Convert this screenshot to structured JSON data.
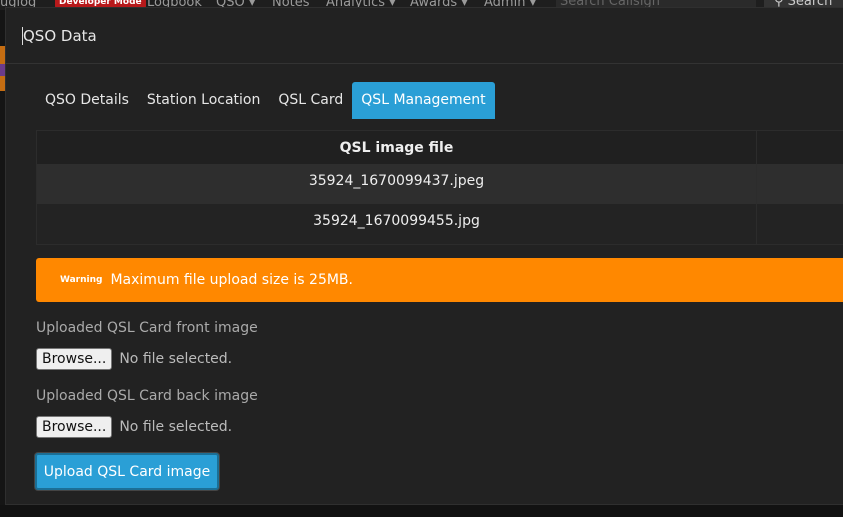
{
  "navbar": {
    "brand": "uglog",
    "badge": "Developer Mode",
    "items": [
      "Logbook",
      "QSO ▾",
      "Notes",
      "Analytics ▾",
      "Awards ▾",
      "Admin ▾"
    ],
    "search_placeholder": "Search Callsign",
    "search_button": "Search"
  },
  "modal": {
    "title": "QSO Data",
    "tabs": [
      {
        "label": "QSO Details",
        "active": false
      },
      {
        "label": "Station Location",
        "active": false
      },
      {
        "label": "QSL Card",
        "active": false
      },
      {
        "label": "QSL Management",
        "active": true
      }
    ],
    "table": {
      "header": "QSL image file",
      "rows": [
        "35924_1670099437.jpeg",
        "35924_1670099455.jpg"
      ]
    },
    "alert": {
      "badge": "Warning",
      "text": "Maximum file upload size is 25MB."
    },
    "front": {
      "label": "Uploaded QSL Card front image",
      "browse": "Browse...",
      "status": "No file selected."
    },
    "back": {
      "label": "Uploaded QSL Card back image",
      "browse": "Browse...",
      "status": "No file selected."
    },
    "upload_button": "Upload QSL Card image"
  },
  "colors": {
    "accent": "#2a9fd6",
    "warning": "#ff8800",
    "badge": "#b7191b"
  }
}
